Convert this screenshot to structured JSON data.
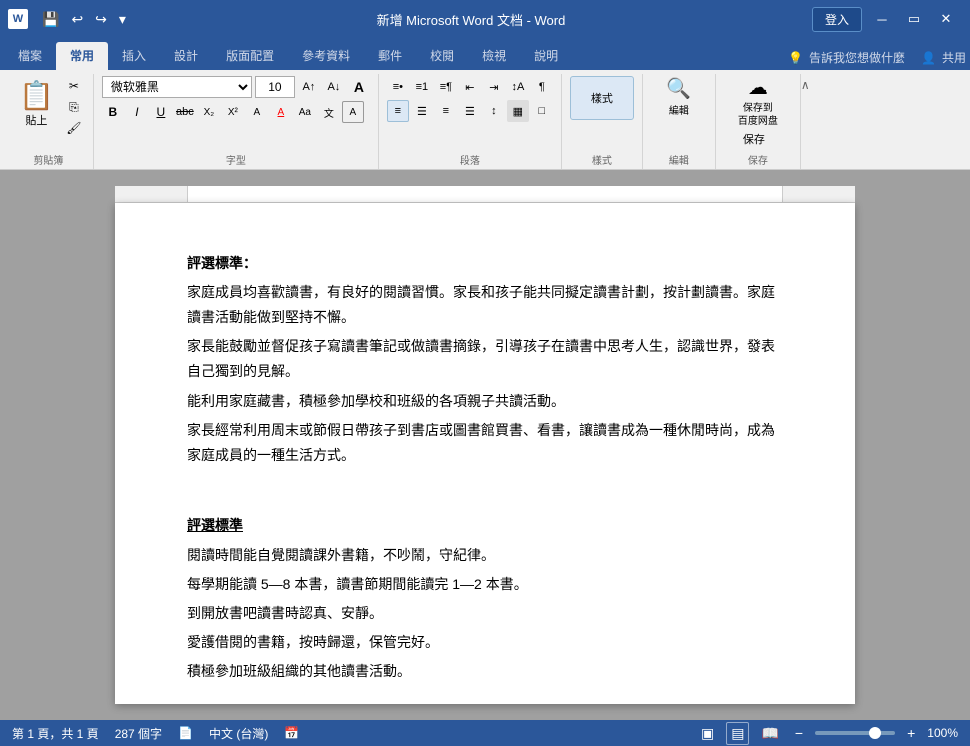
{
  "titleBar": {
    "title": "新增 Microsoft Word 文档 - Word",
    "appName": "Word",
    "signinLabel": "登入"
  },
  "tabs": {
    "items": [
      "檔案",
      "常用",
      "插入",
      "設計",
      "版面配置",
      "參考資料",
      "郵件",
      "校閱",
      "檢視",
      "說明"
    ],
    "active": "常用",
    "rightLabel": "告訴我您想做什麼",
    "shareLabel": "共用"
  },
  "ribbon": {
    "clipboard": {
      "pasteLabel": "貼上",
      "groupLabel": "剪貼簿"
    },
    "font": {
      "fontName": "微软雅黑",
      "fontSize": "10",
      "groupLabel": "字型",
      "bold": "B",
      "italic": "I",
      "underline": "U",
      "strikethrough": "abc",
      "subscript": "X₂",
      "superscript": "X²"
    },
    "paragraph": {
      "groupLabel": "段落"
    },
    "styles": {
      "groupLabel": "樣式",
      "label": "樣式"
    },
    "edit": {
      "groupLabel": "編輯",
      "label": "編輯"
    },
    "save": {
      "groupLabel": "保存",
      "label": "保存到\n百度网盘",
      "label2": "保存"
    }
  },
  "document": {
    "paragraphs": [
      {
        "type": "heading",
        "text": "評選標準："
      },
      {
        "type": "body",
        "text": "家庭成員均喜歡讀書，有良好的閱讀習慣。家長和孩子能共同擬定讀書計劃，按計劃讀書。家庭讀書活動能做到堅持不懈。"
      },
      {
        "type": "body",
        "text": "家長能鼓勵並督促孩子寫讀書筆記或做讀書摘錄，引導孩子在讀書中思考人生，認識世界，發表自己獨到的見解。"
      },
      {
        "type": "body",
        "text": "能利用家庭藏書，積極參加學校和班級的各項親子共讀活動。"
      },
      {
        "type": "body",
        "text": "家長經常利用周末或節假日帶孩子到書店或圖書館買書、看書，讓讀書成為一種休閒時尚，成為家庭成員的一種生活方式。"
      },
      {
        "type": "empty",
        "text": ""
      },
      {
        "type": "heading",
        "text": "評選標準",
        "underline": true
      },
      {
        "type": "body",
        "text": "閱讀時間能自覺閱讀課外書籍，不吵鬧，守紀律。"
      },
      {
        "type": "body",
        "text": "每學期能讀 5—8 本書，讀書節期間能讀完 1—2 本書。"
      },
      {
        "type": "body",
        "text": "到開放書吧讀書時認真、安靜。"
      },
      {
        "type": "body",
        "text": "愛護借閱的書籍，按時歸還，保管完好。"
      },
      {
        "type": "body",
        "text": "積極參加班級組織的其他讀書活動。"
      }
    ]
  },
  "statusBar": {
    "pageInfo": "第 1 頁，共 1 頁",
    "wordCount": "287 個字",
    "language": "中文 (台灣)",
    "zoom": "100%"
  }
}
